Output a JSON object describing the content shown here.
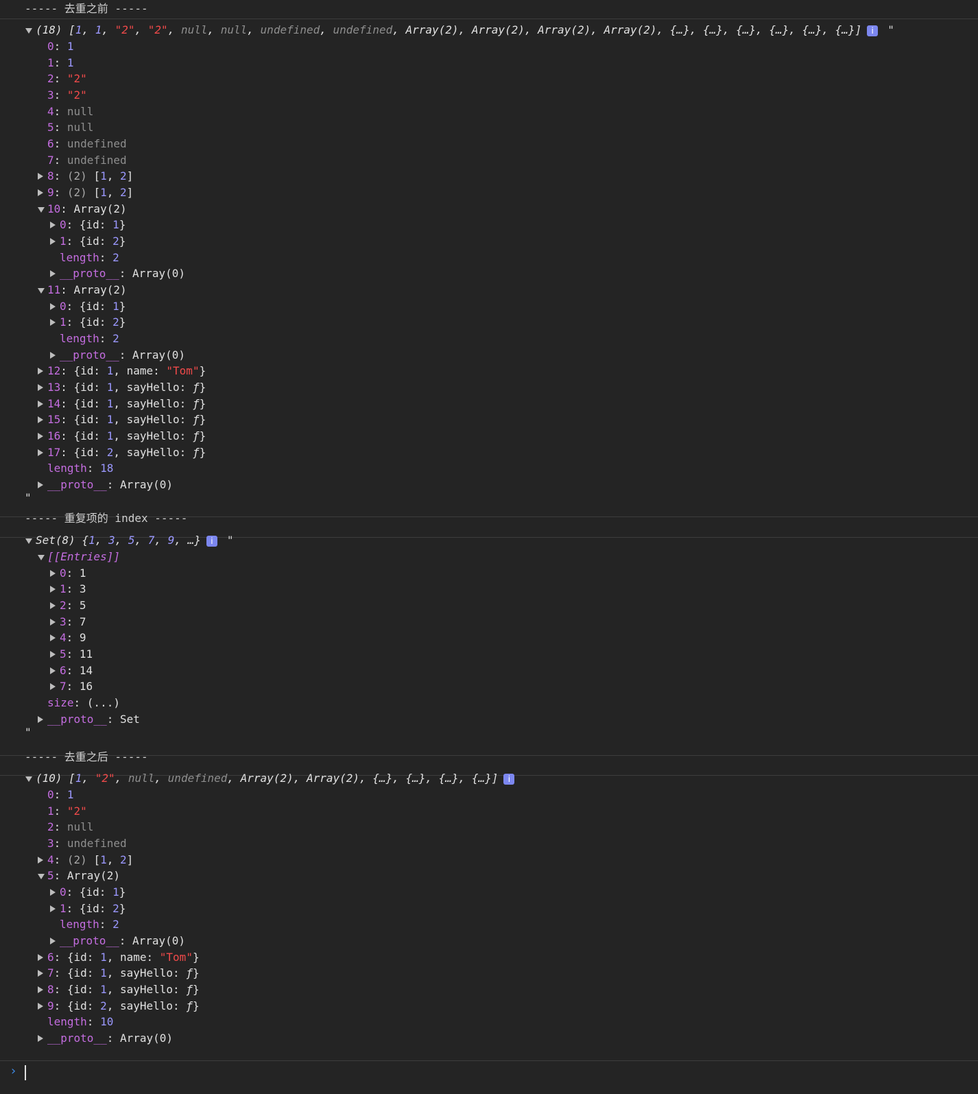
{
  "sections": [
    {
      "header": "----- 去重之前 -----",
      "summary": {
        "prefix": "(18) [",
        "items": [
          {
            "t": "num",
            "v": "1"
          },
          {
            "t": "num",
            "v": "1"
          },
          {
            "t": "str",
            "v": "\"2\""
          },
          {
            "t": "str",
            "v": "\"2\""
          },
          {
            "t": "nul",
            "v": "null"
          },
          {
            "t": "nul",
            "v": "null"
          },
          {
            "t": "nul",
            "v": "undefined"
          },
          {
            "t": "nul",
            "v": "undefined"
          },
          {
            "t": "txt",
            "v": "Array(2)"
          },
          {
            "t": "txt",
            "v": "Array(2)"
          },
          {
            "t": "txt",
            "v": "Array(2)"
          },
          {
            "t": "txt",
            "v": "Array(2)"
          },
          {
            "t": "txt",
            "v": "{…}"
          },
          {
            "t": "txt",
            "v": "{…}"
          },
          {
            "t": "txt",
            "v": "{…}"
          },
          {
            "t": "txt",
            "v": "{…}"
          },
          {
            "t": "txt",
            "v": "{…}"
          },
          {
            "t": "txt",
            "v": "{…}"
          }
        ],
        "suffix": "]",
        "trailing_quote": "\""
      },
      "rows": [
        {
          "indent": 1,
          "k": "0",
          "v": [
            {
              "t": "num",
              "v": "1"
            }
          ]
        },
        {
          "indent": 1,
          "k": "1",
          "v": [
            {
              "t": "num",
              "v": "1"
            }
          ]
        },
        {
          "indent": 1,
          "k": "2",
          "v": [
            {
              "t": "str",
              "v": "\"2\""
            }
          ]
        },
        {
          "indent": 1,
          "k": "3",
          "v": [
            {
              "t": "str",
              "v": "\"2\""
            }
          ]
        },
        {
          "indent": 1,
          "k": "4",
          "v": [
            {
              "t": "nul",
              "v": "null"
            }
          ]
        },
        {
          "indent": 1,
          "k": "5",
          "v": [
            {
              "t": "nul",
              "v": "null"
            }
          ]
        },
        {
          "indent": 1,
          "k": "6",
          "v": [
            {
              "t": "nul",
              "v": "undefined"
            }
          ]
        },
        {
          "indent": 1,
          "k": "7",
          "v": [
            {
              "t": "nul",
              "v": "undefined"
            }
          ]
        },
        {
          "indent": 1,
          "tri": "right",
          "k": "8",
          "v": [
            {
              "t": "dim",
              "v": "(2) "
            },
            {
              "t": "txt",
              "v": "["
            },
            {
              "t": "num",
              "v": "1"
            },
            {
              "t": "txt",
              "v": ", "
            },
            {
              "t": "num",
              "v": "2"
            },
            {
              "t": "txt",
              "v": "]"
            }
          ]
        },
        {
          "indent": 1,
          "tri": "right",
          "k": "9",
          "v": [
            {
              "t": "dim",
              "v": "(2) "
            },
            {
              "t": "txt",
              "v": "["
            },
            {
              "t": "num",
              "v": "1"
            },
            {
              "t": "txt",
              "v": ", "
            },
            {
              "t": "num",
              "v": "2"
            },
            {
              "t": "txt",
              "v": "]"
            }
          ]
        },
        {
          "indent": 1,
          "tri": "down",
          "k": "10",
          "v": [
            {
              "t": "txt",
              "v": "Array(2)"
            }
          ]
        },
        {
          "indent": 2,
          "tri": "right",
          "k": "0",
          "v": [
            {
              "t": "txt",
              "v": "{id: "
            },
            {
              "t": "num",
              "v": "1"
            },
            {
              "t": "txt",
              "v": "}"
            }
          ]
        },
        {
          "indent": 2,
          "tri": "right",
          "k": "1",
          "v": [
            {
              "t": "txt",
              "v": "{id: "
            },
            {
              "t": "num",
              "v": "2"
            },
            {
              "t": "txt",
              "v": "}"
            }
          ]
        },
        {
          "indent": 2,
          "k": "length",
          "v": [
            {
              "t": "num",
              "v": "2"
            }
          ]
        },
        {
          "indent": 2,
          "tri": "right",
          "k": "__proto__",
          "v": [
            {
              "t": "txt",
              "v": "Array(0)"
            }
          ]
        },
        {
          "indent": 1,
          "tri": "down",
          "k": "11",
          "v": [
            {
              "t": "txt",
              "v": "Array(2)"
            }
          ]
        },
        {
          "indent": 2,
          "tri": "right",
          "k": "0",
          "v": [
            {
              "t": "txt",
              "v": "{id: "
            },
            {
              "t": "num",
              "v": "1"
            },
            {
              "t": "txt",
              "v": "}"
            }
          ]
        },
        {
          "indent": 2,
          "tri": "right",
          "k": "1",
          "v": [
            {
              "t": "txt",
              "v": "{id: "
            },
            {
              "t": "num",
              "v": "2"
            },
            {
              "t": "txt",
              "v": "}"
            }
          ]
        },
        {
          "indent": 2,
          "k": "length",
          "v": [
            {
              "t": "num",
              "v": "2"
            }
          ]
        },
        {
          "indent": 2,
          "tri": "right",
          "k": "__proto__",
          "v": [
            {
              "t": "txt",
              "v": "Array(0)"
            }
          ]
        },
        {
          "indent": 1,
          "tri": "right",
          "k": "12",
          "v": [
            {
              "t": "txt",
              "v": "{id: "
            },
            {
              "t": "num",
              "v": "1"
            },
            {
              "t": "txt",
              "v": ", name: "
            },
            {
              "t": "str",
              "v": "\"Tom\""
            },
            {
              "t": "txt",
              "v": "}"
            }
          ]
        },
        {
          "indent": 1,
          "tri": "right",
          "k": "13",
          "v": [
            {
              "t": "txt",
              "v": "{id: "
            },
            {
              "t": "num",
              "v": "1"
            },
            {
              "t": "txt",
              "v": ", sayHello: "
            },
            {
              "t": "txt",
              "v": "ƒ",
              "i": true
            },
            {
              "t": "txt",
              "v": "}"
            }
          ]
        },
        {
          "indent": 1,
          "tri": "right",
          "k": "14",
          "v": [
            {
              "t": "txt",
              "v": "{id: "
            },
            {
              "t": "num",
              "v": "1"
            },
            {
              "t": "txt",
              "v": ", sayHello: "
            },
            {
              "t": "txt",
              "v": "ƒ",
              "i": true
            },
            {
              "t": "txt",
              "v": "}"
            }
          ]
        },
        {
          "indent": 1,
          "tri": "right",
          "k": "15",
          "v": [
            {
              "t": "txt",
              "v": "{id: "
            },
            {
              "t": "num",
              "v": "1"
            },
            {
              "t": "txt",
              "v": ", sayHello: "
            },
            {
              "t": "txt",
              "v": "ƒ",
              "i": true
            },
            {
              "t": "txt",
              "v": "}"
            }
          ]
        },
        {
          "indent": 1,
          "tri": "right",
          "k": "16",
          "v": [
            {
              "t": "txt",
              "v": "{id: "
            },
            {
              "t": "num",
              "v": "1"
            },
            {
              "t": "txt",
              "v": ", sayHello: "
            },
            {
              "t": "txt",
              "v": "ƒ",
              "i": true
            },
            {
              "t": "txt",
              "v": "}"
            }
          ]
        },
        {
          "indent": 1,
          "tri": "right",
          "k": "17",
          "v": [
            {
              "t": "txt",
              "v": "{id: "
            },
            {
              "t": "num",
              "v": "2"
            },
            {
              "t": "txt",
              "v": ", sayHello: "
            },
            {
              "t": "txt",
              "v": "ƒ",
              "i": true
            },
            {
              "t": "txt",
              "v": "}"
            }
          ]
        },
        {
          "indent": 1,
          "k": "length",
          "v": [
            {
              "t": "num",
              "v": "18"
            }
          ]
        },
        {
          "indent": 1,
          "tri": "right",
          "k": "__proto__",
          "v": [
            {
              "t": "txt",
              "v": "Array(0)"
            }
          ]
        }
      ],
      "closing": "\""
    },
    {
      "header": "----- 重复项的 index -----",
      "summary": {
        "prefix": "Set(8) {",
        "items": [
          {
            "t": "num",
            "v": "1"
          },
          {
            "t": "num",
            "v": "3"
          },
          {
            "t": "num",
            "v": "5"
          },
          {
            "t": "num",
            "v": "7"
          },
          {
            "t": "num",
            "v": "9"
          },
          {
            "t": "txt",
            "v": "…"
          }
        ],
        "suffix": "}",
        "trailing_quote": "\""
      },
      "rows": [
        {
          "indent": 1,
          "tri": "down",
          "k": "[[Entries]]",
          "kclass": "ital",
          "v": []
        },
        {
          "indent": 2,
          "tri": "right",
          "k": "0",
          "v": [
            {
              "t": "txt",
              "v": "1"
            }
          ]
        },
        {
          "indent": 2,
          "tri": "right",
          "k": "1",
          "v": [
            {
              "t": "txt",
              "v": "3"
            }
          ]
        },
        {
          "indent": 2,
          "tri": "right",
          "k": "2",
          "v": [
            {
              "t": "txt",
              "v": "5"
            }
          ]
        },
        {
          "indent": 2,
          "tri": "right",
          "k": "3",
          "v": [
            {
              "t": "txt",
              "v": "7"
            }
          ]
        },
        {
          "indent": 2,
          "tri": "right",
          "k": "4",
          "v": [
            {
              "t": "txt",
              "v": "9"
            }
          ]
        },
        {
          "indent": 2,
          "tri": "right",
          "k": "5",
          "v": [
            {
              "t": "txt",
              "v": "11"
            }
          ]
        },
        {
          "indent": 2,
          "tri": "right",
          "k": "6",
          "v": [
            {
              "t": "txt",
              "v": "14"
            }
          ]
        },
        {
          "indent": 2,
          "tri": "right",
          "k": "7",
          "v": [
            {
              "t": "txt",
              "v": "16"
            }
          ]
        },
        {
          "indent": 1,
          "k": "size",
          "v": [
            {
              "t": "txt",
              "v": "(...)"
            }
          ]
        },
        {
          "indent": 1,
          "tri": "right",
          "k": "__proto__",
          "v": [
            {
              "t": "txt",
              "v": "Set"
            }
          ]
        }
      ],
      "closing": "\""
    },
    {
      "header": "----- 去重之后 -----",
      "summary": {
        "prefix": "(10) [",
        "items": [
          {
            "t": "num",
            "v": "1"
          },
          {
            "t": "str",
            "v": "\"2\""
          },
          {
            "t": "nul",
            "v": "null"
          },
          {
            "t": "nul",
            "v": "undefined"
          },
          {
            "t": "txt",
            "v": "Array(2)"
          },
          {
            "t": "txt",
            "v": "Array(2)"
          },
          {
            "t": "txt",
            "v": "{…}"
          },
          {
            "t": "txt",
            "v": "{…}"
          },
          {
            "t": "txt",
            "v": "{…}"
          },
          {
            "t": "txt",
            "v": "{…}"
          }
        ],
        "suffix": "]",
        "trailing_quote": ""
      },
      "rows": [
        {
          "indent": 1,
          "k": "0",
          "v": [
            {
              "t": "num",
              "v": "1"
            }
          ]
        },
        {
          "indent": 1,
          "k": "1",
          "v": [
            {
              "t": "str",
              "v": "\"2\""
            }
          ]
        },
        {
          "indent": 1,
          "k": "2",
          "v": [
            {
              "t": "nul",
              "v": "null"
            }
          ]
        },
        {
          "indent": 1,
          "k": "3",
          "v": [
            {
              "t": "nul",
              "v": "undefined"
            }
          ]
        },
        {
          "indent": 1,
          "tri": "right",
          "k": "4",
          "v": [
            {
              "t": "dim",
              "v": "(2) "
            },
            {
              "t": "txt",
              "v": "["
            },
            {
              "t": "num",
              "v": "1"
            },
            {
              "t": "txt",
              "v": ", "
            },
            {
              "t": "num",
              "v": "2"
            },
            {
              "t": "txt",
              "v": "]"
            }
          ]
        },
        {
          "indent": 1,
          "tri": "down",
          "k": "5",
          "v": [
            {
              "t": "txt",
              "v": "Array(2)"
            }
          ]
        },
        {
          "indent": 2,
          "tri": "right",
          "k": "0",
          "v": [
            {
              "t": "txt",
              "v": "{id: "
            },
            {
              "t": "num",
              "v": "1"
            },
            {
              "t": "txt",
              "v": "}"
            }
          ]
        },
        {
          "indent": 2,
          "tri": "right",
          "k": "1",
          "v": [
            {
              "t": "txt",
              "v": "{id: "
            },
            {
              "t": "num",
              "v": "2"
            },
            {
              "t": "txt",
              "v": "}"
            }
          ]
        },
        {
          "indent": 2,
          "k": "length",
          "v": [
            {
              "t": "num",
              "v": "2"
            }
          ]
        },
        {
          "indent": 2,
          "tri": "right",
          "k": "__proto__",
          "v": [
            {
              "t": "txt",
              "v": "Array(0)"
            }
          ]
        },
        {
          "indent": 1,
          "tri": "right",
          "k": "6",
          "v": [
            {
              "t": "txt",
              "v": "{id: "
            },
            {
              "t": "num",
              "v": "1"
            },
            {
              "t": "txt",
              "v": ", name: "
            },
            {
              "t": "str",
              "v": "\"Tom\""
            },
            {
              "t": "txt",
              "v": "}"
            }
          ]
        },
        {
          "indent": 1,
          "tri": "right",
          "k": "7",
          "v": [
            {
              "t": "txt",
              "v": "{id: "
            },
            {
              "t": "num",
              "v": "1"
            },
            {
              "t": "txt",
              "v": ", sayHello: "
            },
            {
              "t": "txt",
              "v": "ƒ",
              "i": true
            },
            {
              "t": "txt",
              "v": "}"
            }
          ]
        },
        {
          "indent": 1,
          "tri": "right",
          "k": "8",
          "v": [
            {
              "t": "txt",
              "v": "{id: "
            },
            {
              "t": "num",
              "v": "1"
            },
            {
              "t": "txt",
              "v": ", sayHello: "
            },
            {
              "t": "txt",
              "v": "ƒ",
              "i": true
            },
            {
              "t": "txt",
              "v": "}"
            }
          ]
        },
        {
          "indent": 1,
          "tri": "right",
          "k": "9",
          "v": [
            {
              "t": "txt",
              "v": "{id: "
            },
            {
              "t": "num",
              "v": "2"
            },
            {
              "t": "txt",
              "v": ", sayHello: "
            },
            {
              "t": "txt",
              "v": "ƒ",
              "i": true
            },
            {
              "t": "txt",
              "v": "}"
            }
          ]
        },
        {
          "indent": 1,
          "k": "length",
          "v": [
            {
              "t": "num",
              "v": "10"
            }
          ]
        },
        {
          "indent": 1,
          "tri": "right",
          "k": "__proto__",
          "v": [
            {
              "t": "txt",
              "v": "Array(0)"
            }
          ]
        }
      ],
      "closing": ""
    }
  ],
  "prompt_symbol": "›",
  "info_icon": "info-icon",
  "colors": {
    "key": "#c46de0",
    "number": "#9b98ff",
    "string": "#f04a4a",
    "null": "#8e8e8e",
    "background": "#242424",
    "prompt": "#3d8ae6"
  }
}
